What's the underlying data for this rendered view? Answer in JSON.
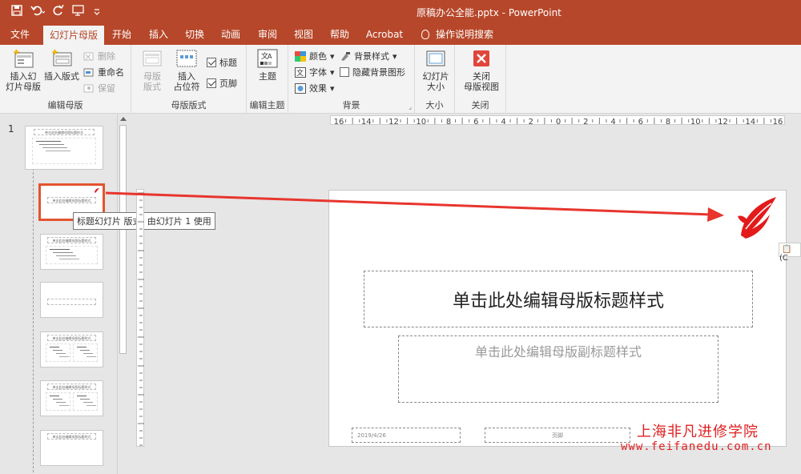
{
  "window": {
    "title": "原稿办公全能.pptx  -  PowerPoint"
  },
  "tabs": [
    {
      "label": "文件"
    },
    {
      "label": "幻灯片母版"
    },
    {
      "label": "开始"
    },
    {
      "label": "插入"
    },
    {
      "label": "切换"
    },
    {
      "label": "动画"
    },
    {
      "label": "审阅"
    },
    {
      "label": "视图"
    },
    {
      "label": "帮助"
    },
    {
      "label": "Acrobat"
    },
    {
      "label": "操作说明搜索"
    }
  ],
  "ribbon": {
    "edit_master": {
      "label": "编辑母版",
      "insert_master": "插入幻\n灯片母版",
      "insert_layout": "插入版式",
      "delete": "删除",
      "rename": "重命名",
      "preserve": "保留"
    },
    "master_layout": {
      "label": "母版版式",
      "master_layout_btn": "母版\n版式",
      "insert_placeholder": "插入\n占位符",
      "title_check": "标题",
      "footer_check": "页脚"
    },
    "edit_theme": {
      "label": "编辑主题",
      "theme": "主题"
    },
    "background": {
      "label": "背景",
      "colors": "颜色",
      "fonts": "字体",
      "effects": "效果",
      "bg_styles": "背景样式",
      "hide_bg": "隐藏背景图形"
    },
    "size": {
      "label": "大小",
      "slide_size": "幻灯片\n大小"
    },
    "close": {
      "label": "关闭",
      "close_master": "关闭\n母版视图"
    }
  },
  "thumbnails": {
    "slide_number": "1",
    "master_title": "单击此处编辑母版标题样式",
    "tooltip": "标题幻灯片 版式: 由幻灯片 1 使用"
  },
  "ruler": {
    "labels": [
      "16",
      "14",
      "12",
      "10",
      "8",
      "6",
      "4",
      "2",
      "0",
      "2",
      "4",
      "6",
      "8",
      "10",
      "12",
      "14",
      "16"
    ]
  },
  "slide": {
    "title": "单击此处编辑母版标题样式",
    "subtitle": "单击此处编辑母版副标题样式",
    "date": "2019/4/26",
    "footer": "页脚"
  },
  "paste_label": "(C",
  "watermark": {
    "line1": "上海非凡进修学院",
    "line2": "www.feifanedu.com.cn"
  },
  "colors": {
    "accent": "#b7472a",
    "arrow": "#e8352e",
    "logo": "#e31b1b"
  }
}
